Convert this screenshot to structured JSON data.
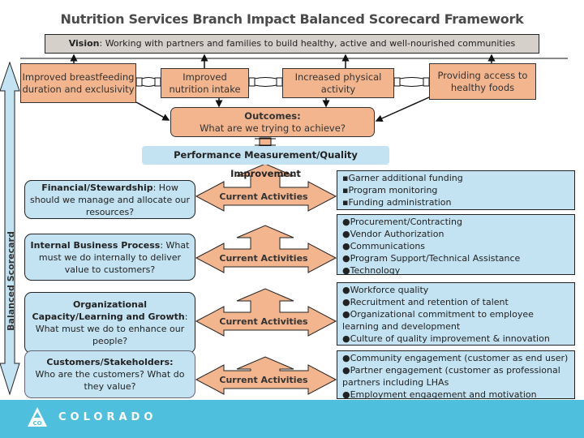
{
  "title": "Nutrition Services Branch Impact Balanced Scorecard Framework",
  "vision": {
    "label": "Vision",
    "text": ": Working with partners and families to build healthy, active and well-nourished communities"
  },
  "goals": [
    {
      "text": "Improved breastfeeding duration and exclusivity"
    },
    {
      "text": "Improved nutrition intake"
    },
    {
      "text": "Increased physical activity"
    },
    {
      "text": "Providing access to healthy foods"
    }
  ],
  "outcomes": {
    "label": "Outcomes:",
    "question": "What are we trying to achieve?"
  },
  "performance_label": "Performance Measurement/Quality Improvement",
  "sidebar_label": "Balanced Scorecard",
  "perspectives": [
    {
      "label": "Financial/Stewardship",
      "question": ": How should we manage and allocate our resources?"
    },
    {
      "label": "Internal Business Process",
      "question": ": What must we do internally to deliver value to customers?"
    },
    {
      "label": "Organizational Capacity/Learning and Growth",
      "question": ": What must we do to enhance our people?"
    },
    {
      "label": "Customers/Stakeholders:",
      "question": "Who are the customers? What do they value?"
    }
  ],
  "current_activities_label": "Current Activities",
  "activities": [
    {
      "items": [
        "▪Garner additional funding",
        "▪Program monitoring",
        "▪Funding administration"
      ]
    },
    {
      "items": [
        "●Procurement/Contracting",
        "●Vendor Authorization",
        "●Communications",
        "●Program Support/Technical Assistance",
        "●Technology"
      ]
    },
    {
      "items": [
        "●Workforce quality",
        "●Recruitment and retention of talent",
        "●Organizational commitment to employee",
        "learning and development",
        "●Culture of quality improvement & innovation"
      ]
    },
    {
      "items": [
        "●Community engagement (customer as end user)",
        "●Partner engagement (customer as professional",
        "partners including LHAs",
        "●Employment engagement and motivation"
      ]
    }
  ],
  "footer": {
    "brand": "COLORADO",
    "logo_text": "CO",
    "color": "#4fbfde"
  },
  "colors": {
    "orange": "#f3b58e",
    "light_blue": "#c4e3f2",
    "vision_gray": "#d6d0cb"
  }
}
